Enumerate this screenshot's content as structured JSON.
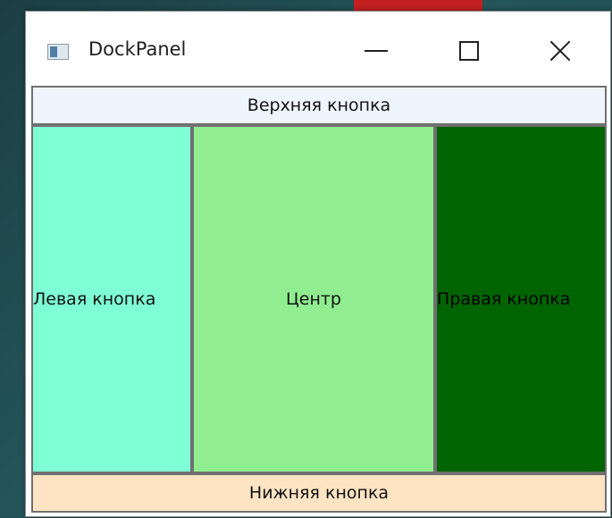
{
  "window": {
    "title": "DockPanel"
  },
  "buttons": {
    "top": "Верхняя кнопка",
    "left": "Левая кнопка",
    "center": "Центр",
    "right": "Правая кнопка",
    "bottom": "Нижняя кнопка"
  },
  "colors": {
    "top": "#eef5fc",
    "left": "#7fffd4",
    "center": "#90ee90",
    "right": "#006400",
    "bottom": "#ffe4c4"
  },
  "icons": {
    "app": "window-app-icon",
    "minimize": "minimize-icon",
    "maximize": "maximize-icon",
    "close": "close-icon"
  }
}
